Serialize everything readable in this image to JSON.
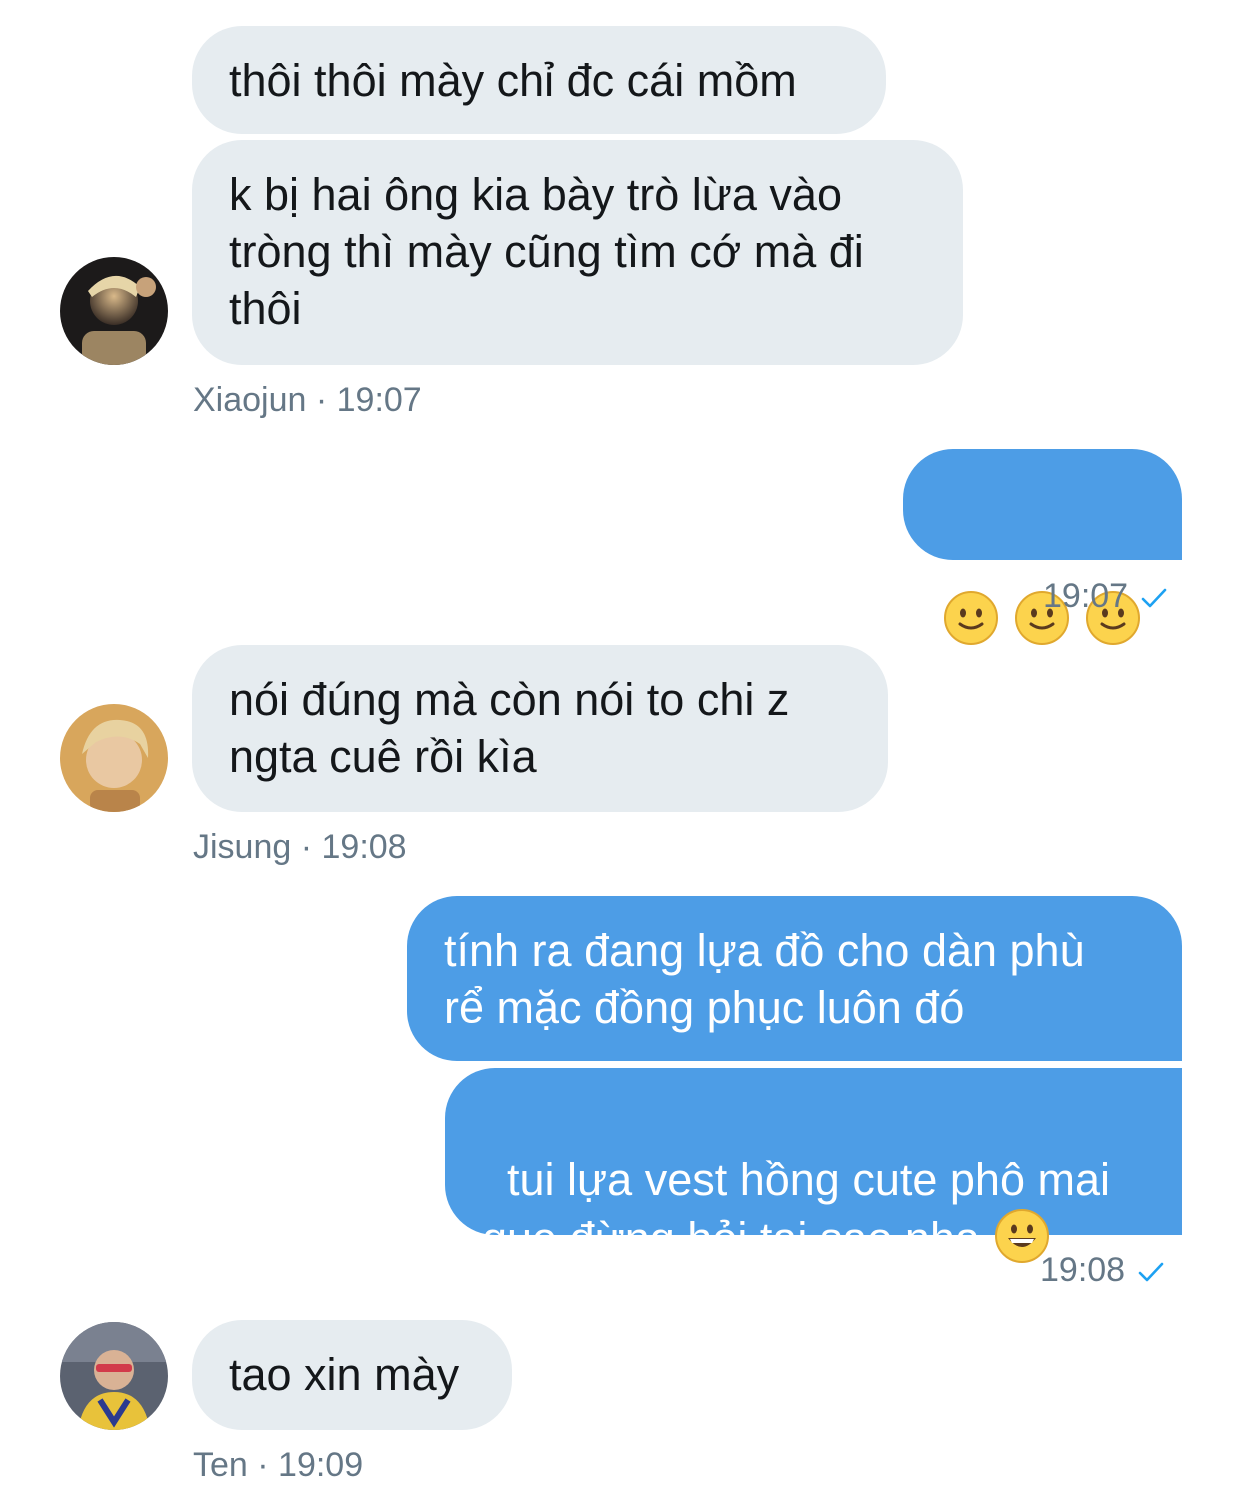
{
  "conversation": {
    "messages": [
      {
        "sender": "Xiaojun",
        "direction": "incoming",
        "text": "thôi thôi mày chỉ đc cái mồm"
      },
      {
        "sender": "Xiaojun",
        "direction": "incoming",
        "text": "k bị hai ông kia bày trò lừa vào\ntròng thì mày cũng tìm cớ mà đi\nthôi"
      },
      {
        "sender": "me",
        "direction": "outgoing",
        "emojis": [
          "slightly-smiling-face",
          "slightly-smiling-face",
          "slightly-smiling-face"
        ]
      },
      {
        "sender": "Jisung",
        "direction": "incoming",
        "text": "nói đúng mà còn nói to chi z\nngta cuê rồi kìa"
      },
      {
        "sender": "me",
        "direction": "outgoing",
        "text": "tính ra đang lựa đồ cho dàn phù\nrể mặc đồng phục luôn đó"
      },
      {
        "sender": "me",
        "direction": "outgoing",
        "text": "tui lựa vest hồng cute phô mai\nque đừng hỏi tại sao nha",
        "trailing_emoji": "grinning-face"
      },
      {
        "sender": "Ten",
        "direction": "incoming",
        "text": "tao xin mày"
      }
    ],
    "meta": {
      "xiaojun": "Xiaojun · 19:07",
      "out1": "19:07",
      "jisung": "Jisung · 19:08",
      "out2": "19:08",
      "ten": "Ten · 19:09"
    }
  },
  "colors": {
    "incoming_bubble": "#e6ecf0",
    "outgoing_bubble": "#4d9de6",
    "meta_text": "#657786",
    "read_check": "#1da1f2"
  }
}
